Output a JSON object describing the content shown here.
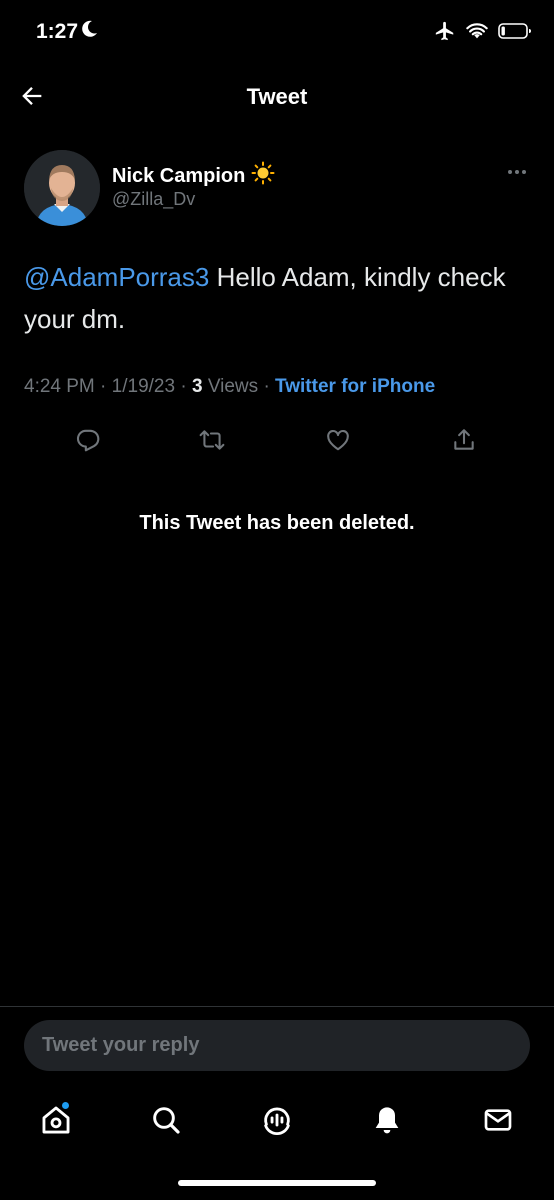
{
  "status_bar": {
    "time": "1:27",
    "icons": [
      "moon-icon",
      "airplane-icon",
      "wifi-icon",
      "battery-icon"
    ],
    "battery_level": 0.15
  },
  "header": {
    "title": "Tweet",
    "back_icon": "arrow-left-icon"
  },
  "tweet": {
    "author_name": "Nick Campion",
    "author_emoji": "☀️",
    "author_handle": "@Zilla_Dv",
    "mention": "@AdamPorras3",
    "text": " Hello Adam, kindly check your dm.",
    "time": "4:24 PM",
    "date": "1/19/23",
    "views_count": "3",
    "views_label": "Views",
    "separator": "·",
    "source": "Twitter for iPhone",
    "actions": [
      "reply-icon",
      "retweet-icon",
      "like-icon",
      "share-icon"
    ]
  },
  "deleted_notice": "This Tweet has been deleted.",
  "reply": {
    "placeholder": "Tweet your reply"
  },
  "tabbar": {
    "items": [
      "home-icon",
      "search-icon",
      "spaces-icon",
      "notifications-icon",
      "messages-icon"
    ],
    "home_badge": true
  },
  "colors": {
    "background": "#000000",
    "accent": "#1d9bf0",
    "link": "#4a99e9",
    "secondary_text": "#71767b",
    "primary_text": "#e7e9ea"
  }
}
